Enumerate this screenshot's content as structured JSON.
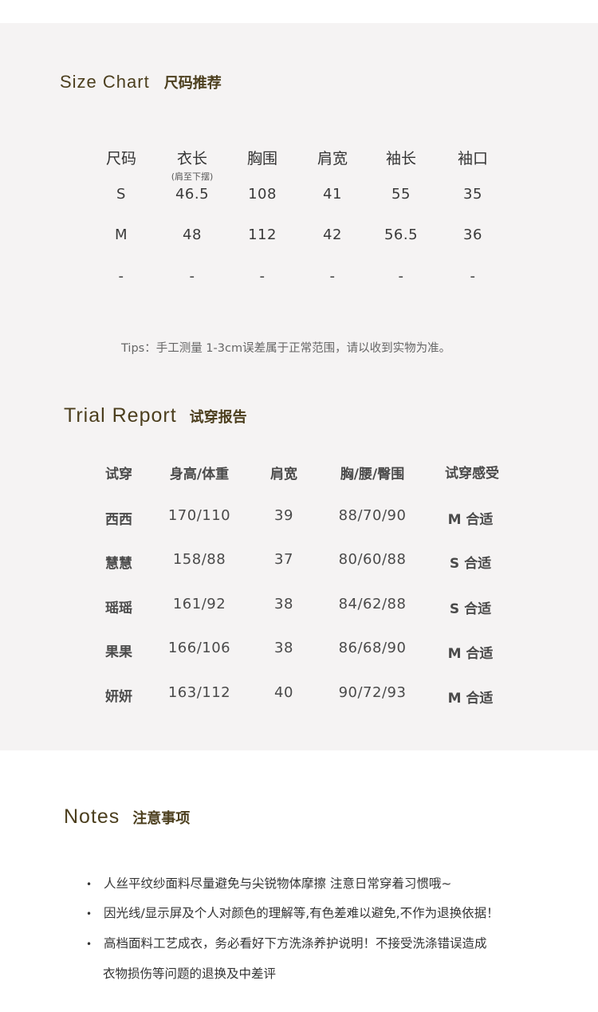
{
  "size_chart": {
    "title_en": "Size Chart",
    "title_zh": "尺码推荐",
    "headers": [
      "尺码",
      "衣长",
      "胸围",
      "肩宽",
      "袖长",
      "袖口"
    ],
    "length_note": "(肩至下摆)",
    "rows": [
      [
        "S",
        "46.5",
        "108",
        "41",
        "55",
        "35"
      ],
      [
        "M",
        "48",
        "112",
        "42",
        "56.5",
        "36"
      ],
      [
        "-",
        "-",
        "-",
        "-",
        "-",
        "-"
      ]
    ],
    "tips": "Tips：手工测量 1-3cm误差属于正常范围，请以收到实物为准。"
  },
  "trial_report": {
    "title_en": "Trial Report",
    "title_zh": "试穿报告",
    "headers": [
      "试穿",
      "身高/体重",
      "肩宽",
      "胸/腰/臀围",
      "试穿感受"
    ],
    "rows": [
      [
        "西西",
        "170/110",
        "39",
        "88/70/90",
        "M 合适"
      ],
      [
        "慧慧",
        "158/88",
        "37",
        "80/60/88",
        "S 合适"
      ],
      [
        "瑶瑶",
        "161/92",
        "38",
        "84/62/88",
        "S 合适"
      ],
      [
        "果果",
        "166/106",
        "38",
        "86/68/90",
        "M 合适"
      ],
      [
        "妍妍",
        "163/112",
        "40",
        "90/72/93",
        "M 合适"
      ]
    ]
  },
  "notes": {
    "title_en": "Notes",
    "title_zh": "注意事项",
    "bullet": "•",
    "items": [
      "人丝平纹纱面料尽量避免与尖锐物体摩擦 注意日常穿着习惯哦~",
      "因光线/显示屏及个人对颜色的理解等,有色差难以避免,不作为退换依据！",
      "高档面料工艺成衣，务必看好下方洗涤养护说明！不接受洗涤错误造成"
    ],
    "item3_continued": "衣物损伤等问题的退换及中差评"
  },
  "colors": {
    "panel_bg": "#f5f3f3",
    "title_accent": "#4c3f1e",
    "text": "#3a3a3a"
  }
}
